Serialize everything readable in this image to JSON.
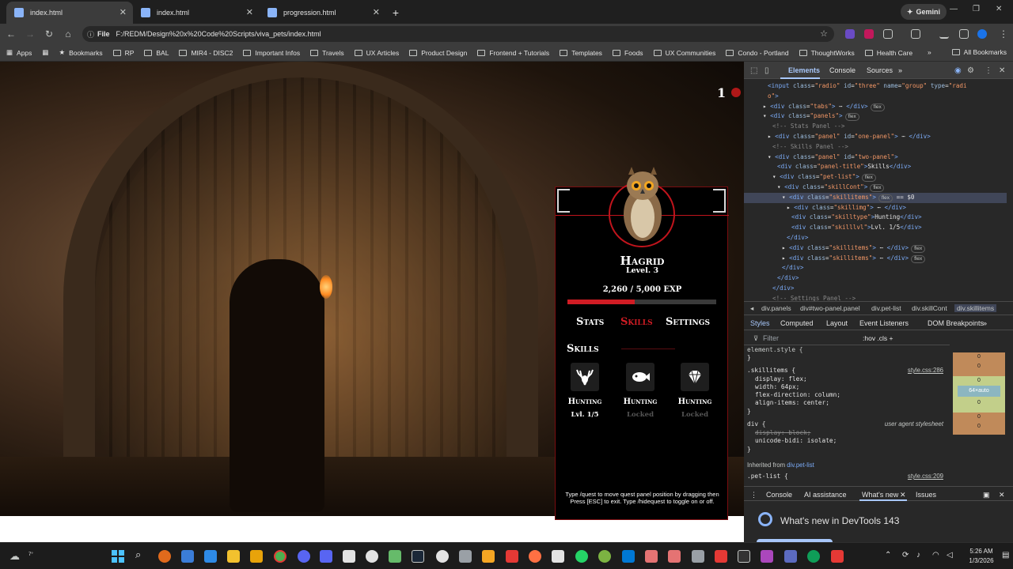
{
  "browser": {
    "tabs": [
      {
        "title": "index.html",
        "active": true
      },
      {
        "title": "index.html",
        "active": false
      },
      {
        "title": "progression.html",
        "active": false
      }
    ],
    "gemini_label": "Gemini",
    "url_chip": "File",
    "url": "F:/REDM/Design%20x%20Code%20Scripts/viva_pets/index.html",
    "bookmarks": {
      "apps": "Apps",
      "items": [
        "Bookmarks",
        "RP",
        "BAL",
        "MIR4 - DISC2",
        "Important Infos",
        "Travels",
        "UX Articles",
        "Product Design",
        "Frontend + Tutorials",
        "Templates",
        "Foods",
        "UX Communities",
        "Condo - Portland",
        "ThoughtWorks",
        "Health Care"
      ],
      "more": "»",
      "all": "All Bookmarks"
    }
  },
  "game": {
    "counter": "1",
    "pet": {
      "name": "Hagrid",
      "level": "Level. 3",
      "exp": "2,260 / 5,000 EXP",
      "exp_fraction": 0.452
    },
    "tabs": [
      {
        "label": "Stats",
        "active": false
      },
      {
        "label": "Skills",
        "active": true
      },
      {
        "label": "Settings",
        "active": false
      }
    ],
    "section_title": "Skills",
    "skills": [
      {
        "type": "Hunting",
        "level": "Lvl. 1/5",
        "locked": false,
        "icon": "deer-icon"
      },
      {
        "type": "Hunting",
        "level": "Locked",
        "locked": true,
        "icon": "fish-icon"
      },
      {
        "type": "Hunting",
        "level": "Locked",
        "locked": true,
        "icon": "diamond-icon"
      }
    ],
    "hint": "Type /quest to move quest panel position by dragging then Press [ESC] to exit. Type /hidequest to toggle on or off."
  },
  "devtools": {
    "tabs": [
      "Elements",
      "Console",
      "Sources",
      "»"
    ],
    "dom": [
      {
        "indent": 5,
        "html": "<span class='tag'>&lt;input</span> <span class='attr'>class</span>=<span class='val'>\"radio\"</span> <span class='attr'>id</span>=<span class='val'>\"three\"</span> <span class='attr'>name</span>=<span class='val'>\"group\"</span> <span class='attr'>type</span>=<span class='val'>\"radi</span>"
      },
      {
        "indent": 5,
        "html": "<span class='val'>o\"</span><span class='tag'>&gt;</span>"
      },
      {
        "indent": 4,
        "html": "▸ <span class='tag'>&lt;div</span> <span class='attr'>class</span>=<span class='val'>\"tabs\"</span><span class='tag'>&gt;</span> ⋯ <span class='tag'>&lt;/div&gt;</span><span class='badge'>flex</span>"
      },
      {
        "indent": 4,
        "html": "▾ <span class='tag'>&lt;div</span> <span class='attr'>class</span>=<span class='val'>\"panels\"</span><span class='tag'>&gt;</span><span class='badge'>flex</span>"
      },
      {
        "indent": 6,
        "html": "<span class='cmt'>&lt;!-- Stats Panel --&gt;</span>"
      },
      {
        "indent": 5,
        "html": "▸ <span class='tag'>&lt;div</span> <span class='attr'>class</span>=<span class='val'>\"panel\"</span> <span class='attr'>id</span>=<span class='val'>\"one-panel\"</span><span class='tag'>&gt;</span> ⋯ <span class='tag'>&lt;/div&gt;</span>"
      },
      {
        "indent": 6,
        "html": "<span class='cmt'>&lt;!-- Skills Panel --&gt;</span>"
      },
      {
        "indent": 5,
        "html": "▾ <span class='tag'>&lt;div</span> <span class='attr'>class</span>=<span class='val'>\"panel\"</span> <span class='attr'>id</span>=<span class='val'>\"two-panel\"</span><span class='tag'>&gt;</span>"
      },
      {
        "indent": 7,
        "html": "<span class='tag'>&lt;div</span> <span class='attr'>class</span>=<span class='val'>\"panel-title\"</span><span class='tag'>&gt;</span>Skills<span class='tag'>&lt;/div&gt;</span>"
      },
      {
        "indent": 6,
        "html": "▾ <span class='tag'>&lt;div</span> <span class='attr'>class</span>=<span class='val'>\"pet-list\"</span><span class='tag'>&gt;</span><span class='badge'>flex</span>"
      },
      {
        "indent": 7,
        "html": "▾ <span class='tag'>&lt;div</span> <span class='attr'>class</span>=<span class='val'>\"skillCont\"</span><span class='tag'>&gt;</span><span class='badge'>flex</span>"
      },
      {
        "indent": 8,
        "html": "▾ <span class='tag'>&lt;div</span> <span class='attr'>class</span>=<span class='val'>\"skillitems\"</span><span class='tag'>&gt;</span><span class='badge'>flex</span> == $0",
        "selected": true
      },
      {
        "indent": 9,
        "html": "▸ <span class='tag'>&lt;div</span> <span class='attr'>class</span>=<span class='val'>\"skillimg\"</span><span class='tag'>&gt;</span> ⋯ <span class='tag'>&lt;/div&gt;</span>"
      },
      {
        "indent": 10,
        "html": "<span class='tag'>&lt;div</span> <span class='attr'>class</span>=<span class='val'>\"skilltype\"</span><span class='tag'>&gt;</span>Hunting<span class='tag'>&lt;/div&gt;</span>"
      },
      {
        "indent": 10,
        "html": "<span class='tag'>&lt;div</span> <span class='attr'>class</span>=<span class='val'>\"skilllvl\"</span><span class='tag'>&gt;</span>Lvl. 1/5<span class='tag'>&lt;/div&gt;</span>"
      },
      {
        "indent": 9,
        "html": "<span class='tag'>&lt;/div&gt;</span>"
      },
      {
        "indent": 8,
        "html": "▸ <span class='tag'>&lt;div</span> <span class='attr'>class</span>=<span class='val'>\"skillitems\"</span><span class='tag'>&gt;</span> ⋯ <span class='tag'>&lt;/div&gt;</span><span class='badge'>flex</span>"
      },
      {
        "indent": 8,
        "html": "▸ <span class='tag'>&lt;div</span> <span class='attr'>class</span>=<span class='val'>\"skillitems\"</span><span class='tag'>&gt;</span> ⋯ <span class='tag'>&lt;/div&gt;</span><span class='badge'>flex</span>"
      },
      {
        "indent": 8,
        "html": "<span class='tag'>&lt;/div&gt;</span>"
      },
      {
        "indent": 7,
        "html": "<span class='tag'>&lt;/div&gt;</span>"
      },
      {
        "indent": 6,
        "html": "<span class='tag'>&lt;/div&gt;</span>"
      },
      {
        "indent": 6,
        "html": "<span class='cmt'>&lt;!-- Settings Panel --&gt;</span>"
      }
    ],
    "breadcrumbs": [
      "div.panels",
      "div#two-panel.panel",
      "div.pet-list",
      "div.skillCont",
      "div.skillitems"
    ],
    "style_tabs": [
      "Styles",
      "Computed",
      "Layout",
      "Event Listeners",
      "DOM Breakpoints",
      "»"
    ],
    "filter_placeholder": "Filter",
    "filter_tools": ":hov  .cls  +",
    "styles": {
      "element_style": "element.style {",
      "rule1_selector": ".skillitems {",
      "rule1_source": "style.css:286",
      "rule1_props": [
        "display: flex;",
        "width: 64px;",
        "flex-direction: column;",
        "align-items: center;"
      ],
      "rule2_selector": "div {",
      "rule2_source": "user agent stylesheet",
      "rule2_props": [
        "display: block;",
        "unicode-bidi: isolate;"
      ],
      "inherited_label": "Inherited from",
      "inherited_link": "div.pet-list",
      "rule3_selector": ".pet-list {",
      "rule3_source": "style.css:209"
    },
    "boxmodel": {
      "content": "64×auto",
      "values": [
        "0",
        "0",
        "0",
        "0",
        "0",
        "0"
      ]
    },
    "drawer_tabs": [
      "Console",
      "AI assistance",
      "What's new",
      "Issues"
    ],
    "whats_new": "What's new in DevTools 143"
  },
  "taskbar": {
    "weather_temp": "7°",
    "time": "5:26 AM",
    "date": "1/3/2026"
  }
}
